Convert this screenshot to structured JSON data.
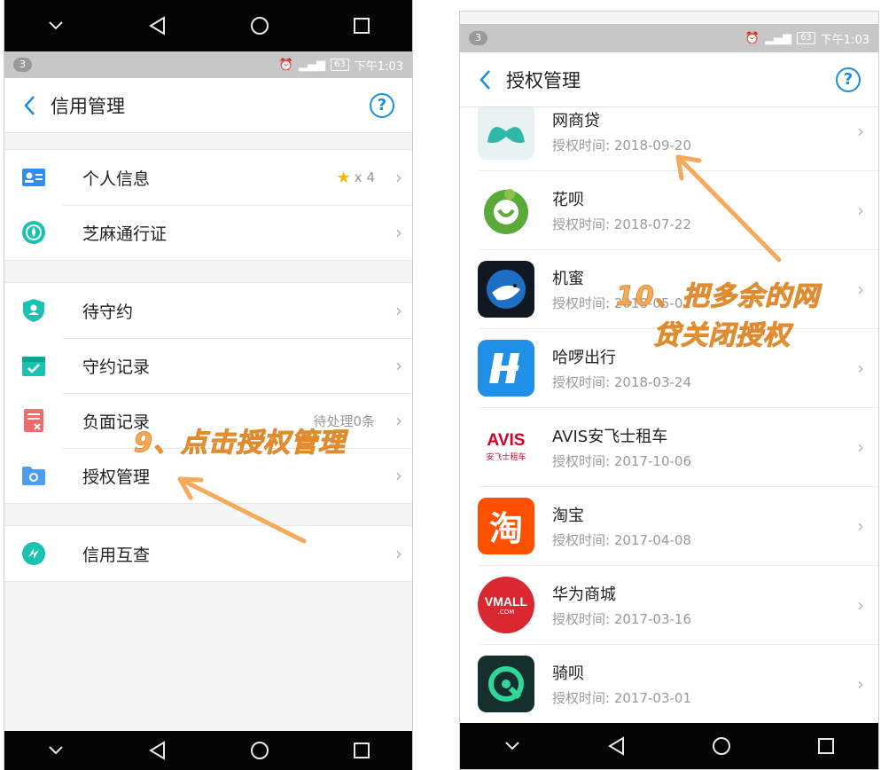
{
  "left": {
    "statusbar": {
      "badge": "3",
      "time": "下午1:03",
      "battery": "63"
    },
    "title": "信用管理",
    "help": "?",
    "items": [
      {
        "label": "个人信息",
        "extra": "x 4"
      },
      {
        "label": "芝麻通行证"
      },
      {
        "label": "待守约"
      },
      {
        "label": "守约记录"
      },
      {
        "label": "负面记录",
        "extra": "待处理0条"
      },
      {
        "label": "授权管理"
      },
      {
        "label": "信用互查"
      }
    ],
    "annotation": "9、点击授权管理"
  },
  "right": {
    "statusbar": {
      "badge": "3",
      "time": "下午1:03",
      "battery": "63"
    },
    "title": "授权管理",
    "help": "?",
    "apps": [
      {
        "name": "网商贷",
        "date": "授权时间: 2018-09-20",
        "color": "#e9f2f3"
      },
      {
        "name": "花呗",
        "date": "授权时间: 2018-07-22",
        "color": "#ffffff"
      },
      {
        "name": "机蜜",
        "date": "授权时间: 2018-05-01",
        "color": "#111821"
      },
      {
        "name": "哈啰出行",
        "date": "授权时间: 2018-03-24",
        "color": "#1f8fe8"
      },
      {
        "name": "AVIS安飞士租车",
        "date": "授权时间: 2017-10-06",
        "color": "#ffffff",
        "logo_text": "AVIS",
        "logo_sub": "安飞士租车"
      },
      {
        "name": "淘宝",
        "date": "授权时间: 2017-04-08",
        "color": "#ff5000",
        "logo_text": "淘"
      },
      {
        "name": "华为商城",
        "date": "授权时间: 2017-03-16",
        "color": "#d9282f",
        "logo_text": "VMALL",
        "logo_sub": ".COM"
      },
      {
        "name": "骑呗",
        "date": "授权时间: 2017-03-01",
        "color": "#15302c"
      }
    ],
    "annotation_line1": "10、把多余的网",
    "annotation_line2": "贷关闭授权"
  }
}
